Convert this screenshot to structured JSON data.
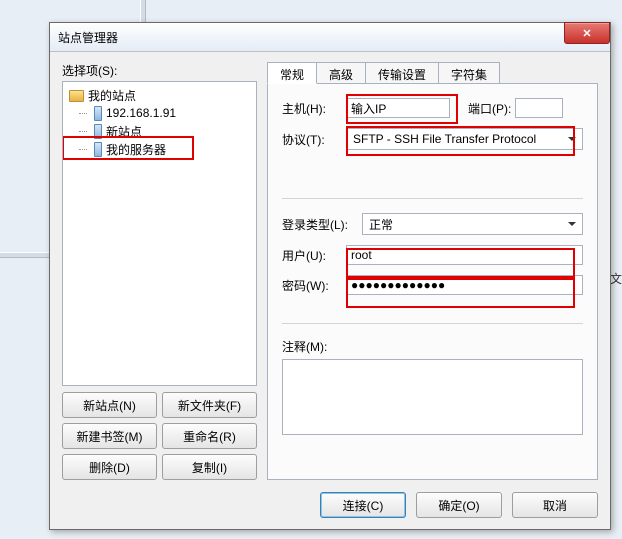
{
  "dialog_title": "站点管理器",
  "select_label": "选择项(S):",
  "tree": {
    "root": "我的站点",
    "items": [
      "192.168.1.91",
      "新站点",
      "我的服务器"
    ]
  },
  "buttons": {
    "new_site": "新站点(N)",
    "new_folder": "新文件夹(F)",
    "new_bookmark": "新建书签(M)",
    "rename": "重命名(R)",
    "delete": "删除(D)",
    "copy": "复制(I)"
  },
  "tabs": [
    "常规",
    "高级",
    "传输设置",
    "字符集"
  ],
  "form": {
    "host_label": "主机(H):",
    "host_value": "输入IP",
    "port_label": "端口(P):",
    "port_value": "",
    "protocol_label": "协议(T):",
    "protocol_value": "SFTP - SSH File Transfer Protocol",
    "logon_type_label": "登录类型(L):",
    "logon_type_value": "正常",
    "user_label": "用户(U):",
    "user_value": "root",
    "password_label": "密码(W):",
    "password_value": "●●●●●●●●●●●●●",
    "comment_label": "注释(M):",
    "comment_value": ""
  },
  "footer": {
    "connect": "连接(C)",
    "ok": "确定(O)",
    "cancel": "取消"
  },
  "bg_text": "文"
}
